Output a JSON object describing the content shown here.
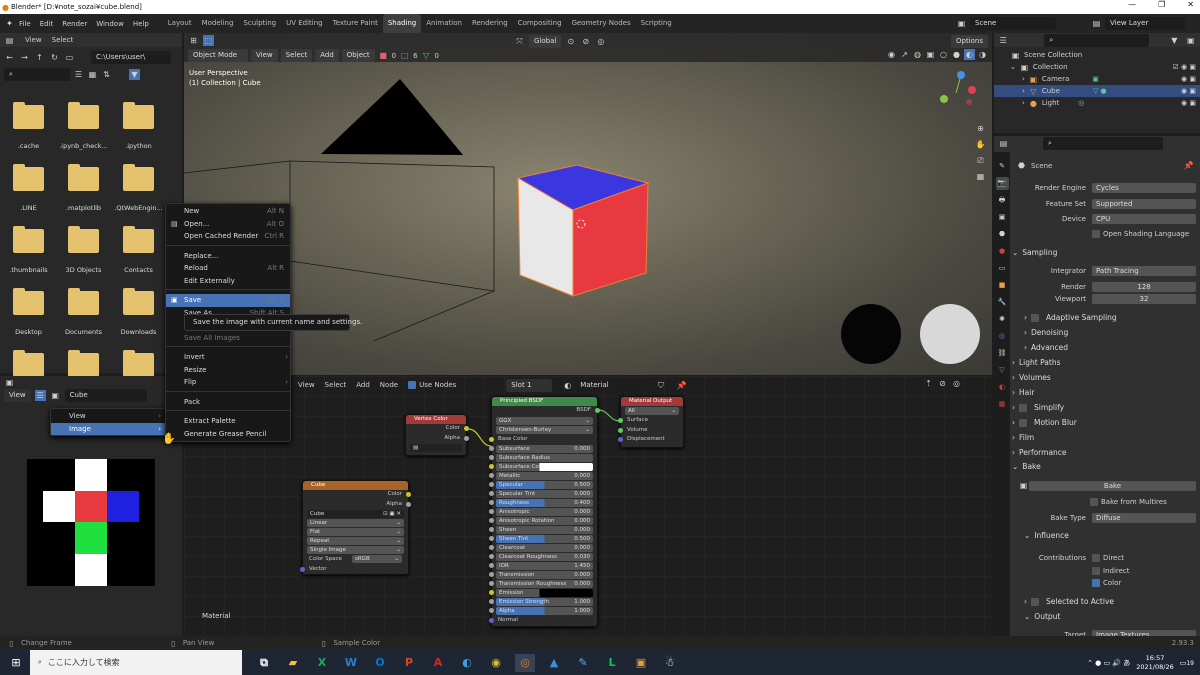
{
  "titlebar": {
    "title": "Blender* [D:¥note_sozai¥cube.blend]"
  },
  "menubar": {
    "menus": [
      "File",
      "Edit",
      "Render",
      "Window",
      "Help"
    ],
    "workspaces": [
      "Layout",
      "Modeling",
      "Sculpting",
      "UV Editing",
      "Texture Paint",
      "Shading",
      "Animation",
      "Rendering",
      "Compositing",
      "Geometry Nodes",
      "Scripting"
    ],
    "active_workspace": "Shading",
    "scene": "Scene",
    "view_layer": "View Layer"
  },
  "filebrowser": {
    "menus": [
      "View",
      "Select"
    ],
    "path": "C:\\Users\\user\\",
    "items": [
      ".cache",
      ".ipynb_check...",
      ".ipython",
      ".LINE",
      ".matplotlib",
      ".QtWebEngin...",
      ".thumbnails",
      "3D Objects",
      "Contacts",
      "Desktop",
      "Documents",
      "Downloads"
    ]
  },
  "viewport": {
    "mode": "Object Mode",
    "menus": [
      "View",
      "Select",
      "Add",
      "Object"
    ],
    "transform": "Global",
    "options": "Options",
    "overlay_line1": "User Perspective",
    "overlay_line2": "(1) Collection | Cube",
    "stat_a": "0",
    "stat_b": "6",
    "stat_c": "0"
  },
  "file_menu": {
    "items": [
      {
        "label": "New",
        "shortcut": "Alt N"
      },
      {
        "label": "Open...",
        "shortcut": "Alt O"
      },
      {
        "label": "Open Cached Render",
        "shortcut": "Ctrl R"
      },
      {
        "label": "Replace...",
        "shortcut": ""
      },
      {
        "label": "Reload",
        "shortcut": "Alt R"
      },
      {
        "label": "Edit Externally",
        "shortcut": ""
      },
      {
        "label": "Save",
        "shortcut": "Alt S"
      },
      {
        "label": "Save As...",
        "shortcut": "Shift Alt S"
      },
      {
        "label": "Save a Copy...",
        "shortcut": ""
      },
      {
        "label": "Save All Images",
        "shortcut": ""
      },
      {
        "label": "Invert",
        "shortcut": ""
      },
      {
        "label": "Resize",
        "shortcut": ""
      },
      {
        "label": "Flip",
        "shortcut": ""
      },
      {
        "label": "Pack",
        "shortcut": ""
      },
      {
        "label": "Extract Palette",
        "shortcut": ""
      },
      {
        "label": "Generate Grease Pencil",
        "shortcut": ""
      }
    ],
    "tooltip": "Save the image with current name and settings."
  },
  "view_menu": {
    "items": [
      "View",
      "Image"
    ]
  },
  "image_editor": {
    "view": "View",
    "image_name": "Cube"
  },
  "node_editor": {
    "menus": [
      "View",
      "Select",
      "Add",
      "Node"
    ],
    "use_nodes": "Use Nodes",
    "slot": "Slot 1",
    "material": "Material",
    "label": "Material",
    "vertex_color": {
      "title": "Vertex Color",
      "out1": "Color",
      "out2": "Alpha"
    },
    "cube_tex": {
      "title": "Cube",
      "out1": "Color",
      "out2": "Alpha",
      "image": "Cube",
      "interp": "Linear",
      "proj": "Flat",
      "ext": "Repeat",
      "source": "Single Image",
      "cs_label": "Color Space",
      "cs_value": "sRGB",
      "vector": "Vector"
    },
    "bsdf": {
      "title": "Principled BSDF",
      "out": "BSDF",
      "dist": "GGX",
      "sss": "Christensen-Burley",
      "base_color": "Base Color",
      "rows": [
        {
          "name": "Subsurface",
          "value": "0.000"
        },
        {
          "name": "Subsurface Radius",
          "value": ""
        },
        {
          "name": "Subsurface Col...",
          "value": ""
        },
        {
          "name": "Metallic",
          "value": "0.000"
        },
        {
          "name": "Specular",
          "value": "0.500"
        },
        {
          "name": "Specular Tint",
          "value": "0.000"
        },
        {
          "name": "Roughness",
          "value": "0.400"
        },
        {
          "name": "Anisotropic",
          "value": "0.000"
        },
        {
          "name": "Anisotropic Rotation",
          "value": "0.000"
        },
        {
          "name": "Sheen",
          "value": "0.000"
        },
        {
          "name": "Sheen Tint",
          "value": "0.500"
        },
        {
          "name": "Clearcoat",
          "value": "0.000"
        },
        {
          "name": "Clearcoat Roughness",
          "value": "0.030"
        },
        {
          "name": "IOR",
          "value": "1.450"
        },
        {
          "name": "Transmission",
          "value": "0.000"
        },
        {
          "name": "Transmission Roughness",
          "value": "0.000"
        },
        {
          "name": "Emission",
          "value": ""
        },
        {
          "name": "Emission Strength",
          "value": "1.000"
        },
        {
          "name": "Alpha",
          "value": "1.000"
        },
        {
          "name": "Normal",
          "value": ""
        }
      ]
    },
    "output": {
      "title": "Material Output",
      "target": "All",
      "in1": "Surface",
      "in2": "Volume",
      "in3": "Displacement"
    }
  },
  "outliner": {
    "root": "Scene Collection",
    "collection": "Collection",
    "items": [
      "Camera",
      "Cube",
      "Light"
    ]
  },
  "properties": {
    "scene": "Scene",
    "render_engine_label": "Render Engine",
    "render_engine": "Cycles",
    "feature_set_label": "Feature Set",
    "feature_set": "Supported",
    "device_label": "Device",
    "device": "CPU",
    "osl": "Open Shading Language",
    "sampling": "Sampling",
    "integrator_label": "Integrator",
    "integrator": "Path Tracing",
    "render_label": "Render",
    "render_samples": "128",
    "viewport_label": "Viewport",
    "viewport_samples": "32",
    "adaptive": "Adaptive Sampling",
    "denoising": "Denoising",
    "advanced": "Advanced",
    "sections": [
      "Light Paths",
      "Volumes",
      "Hair",
      "Simplify",
      "Motion Blur",
      "Film",
      "Performance"
    ],
    "bake": "Bake",
    "bake_button": "Bake",
    "bake_multires": "Bake from Multires",
    "bake_type_label": "Bake Type",
    "bake_type": "Diffuse",
    "influence": "Influence",
    "contributions": "Contributions",
    "direct": "Direct",
    "indirect": "Indirect",
    "color": "Color",
    "selected_to_active": "Selected to Active",
    "output": "Output",
    "target_label": "Target",
    "target": "Image Textures"
  },
  "status": {
    "left": "Change Frame",
    "mid": "Pan View",
    "right": "Sample Color",
    "version": "2.93.3"
  },
  "taskbar": {
    "search": "ここに入力して検索",
    "time": "16:57",
    "date": "2021/08/26",
    "notif": "19"
  }
}
